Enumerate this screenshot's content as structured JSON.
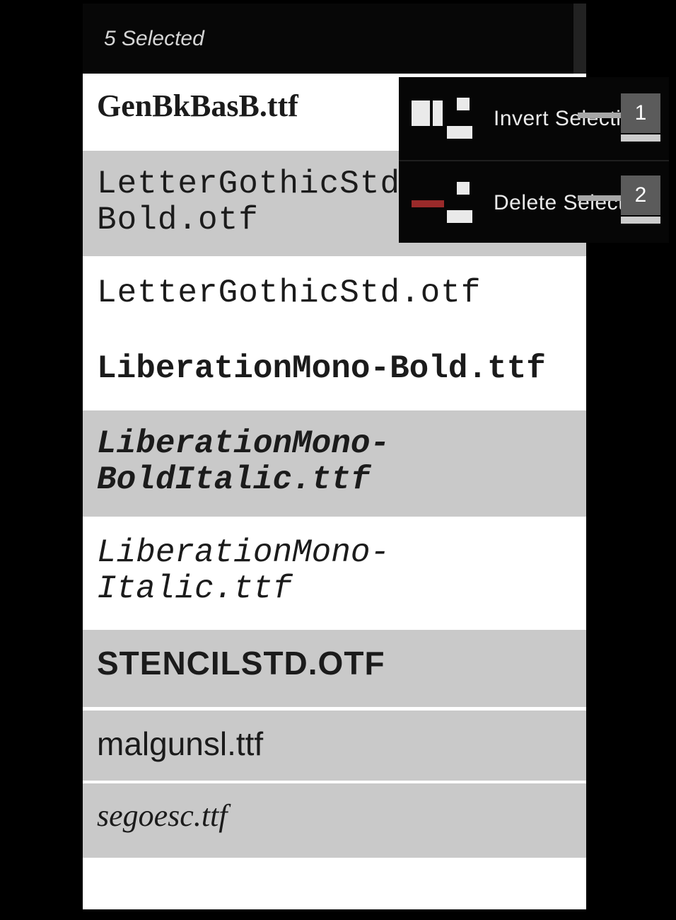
{
  "topbar": {
    "title": "5 Selected"
  },
  "menu": {
    "invert_label": "Invert Selection",
    "delete_label": "Delete Selected"
  },
  "rows": [
    {
      "label": "GenBkBasB.ttf"
    },
    {
      "label": "LetterGothicStd-Bold.otf"
    },
    {
      "label": "LetterGothicStd.otf"
    },
    {
      "label": "LiberationMono-Bold.ttf"
    },
    {
      "label": "LiberationMono-BoldItalic.ttf"
    },
    {
      "label": "LiberationMono-Italic.ttf"
    },
    {
      "label": "STENCILSTD.OTF"
    },
    {
      "label": "malgunsl.ttf"
    },
    {
      "label": "segoesc.ttf"
    }
  ],
  "callouts": {
    "one": "1",
    "two": "2"
  }
}
